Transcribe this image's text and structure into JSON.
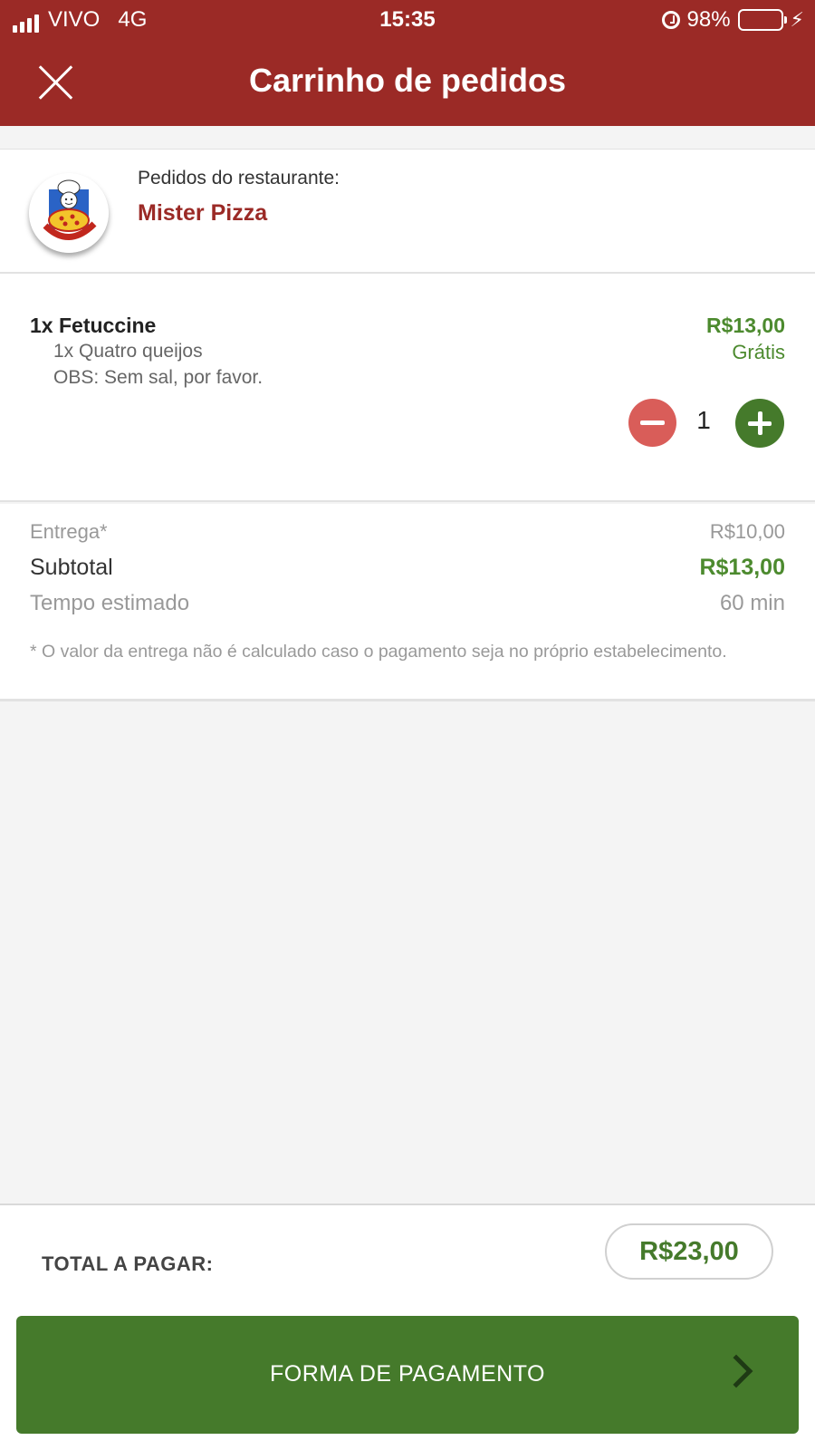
{
  "status_bar": {
    "carrier": "VIVO",
    "network": "4G",
    "time": "15:35",
    "battery": "98%",
    "icons": [
      "signal-icon",
      "alarm-icon",
      "battery-icon",
      "charging-icon"
    ]
  },
  "header": {
    "title": "Carrinho de pedidos",
    "close_icon": "close-icon",
    "color": "#9b2a26"
  },
  "restaurant": {
    "label": "Pedidos do restaurante:",
    "name": "Mister Pizza",
    "logo_text": "MISTER PIZZA"
  },
  "order_item": {
    "name": "1x Fetuccine",
    "option": "1x Quatro queijos",
    "obs": "OBS: Sem sal, por favor.",
    "price": "R$13,00",
    "option_price": "Grátis",
    "quantity": "1"
  },
  "summary": {
    "delivery_label": "Entrega*",
    "delivery_value": "R$10,00",
    "subtotal_label": "Subtotal",
    "subtotal_value": "R$13,00",
    "time_label": "Tempo estimado",
    "time_value": "60 min",
    "note": "* O valor da entrega não é calculado caso o pagamento seja no próprio estabelecimento."
  },
  "footer": {
    "total_label": "TOTAL A PAGAR:",
    "total_value": "R$23,00",
    "pay_button": "FORMA DE PAGAMENTO"
  },
  "colors": {
    "header": "#9b2a26",
    "green": "#457a2b",
    "price_green": "#4c8a2e",
    "minus_red": "#d95d59"
  }
}
